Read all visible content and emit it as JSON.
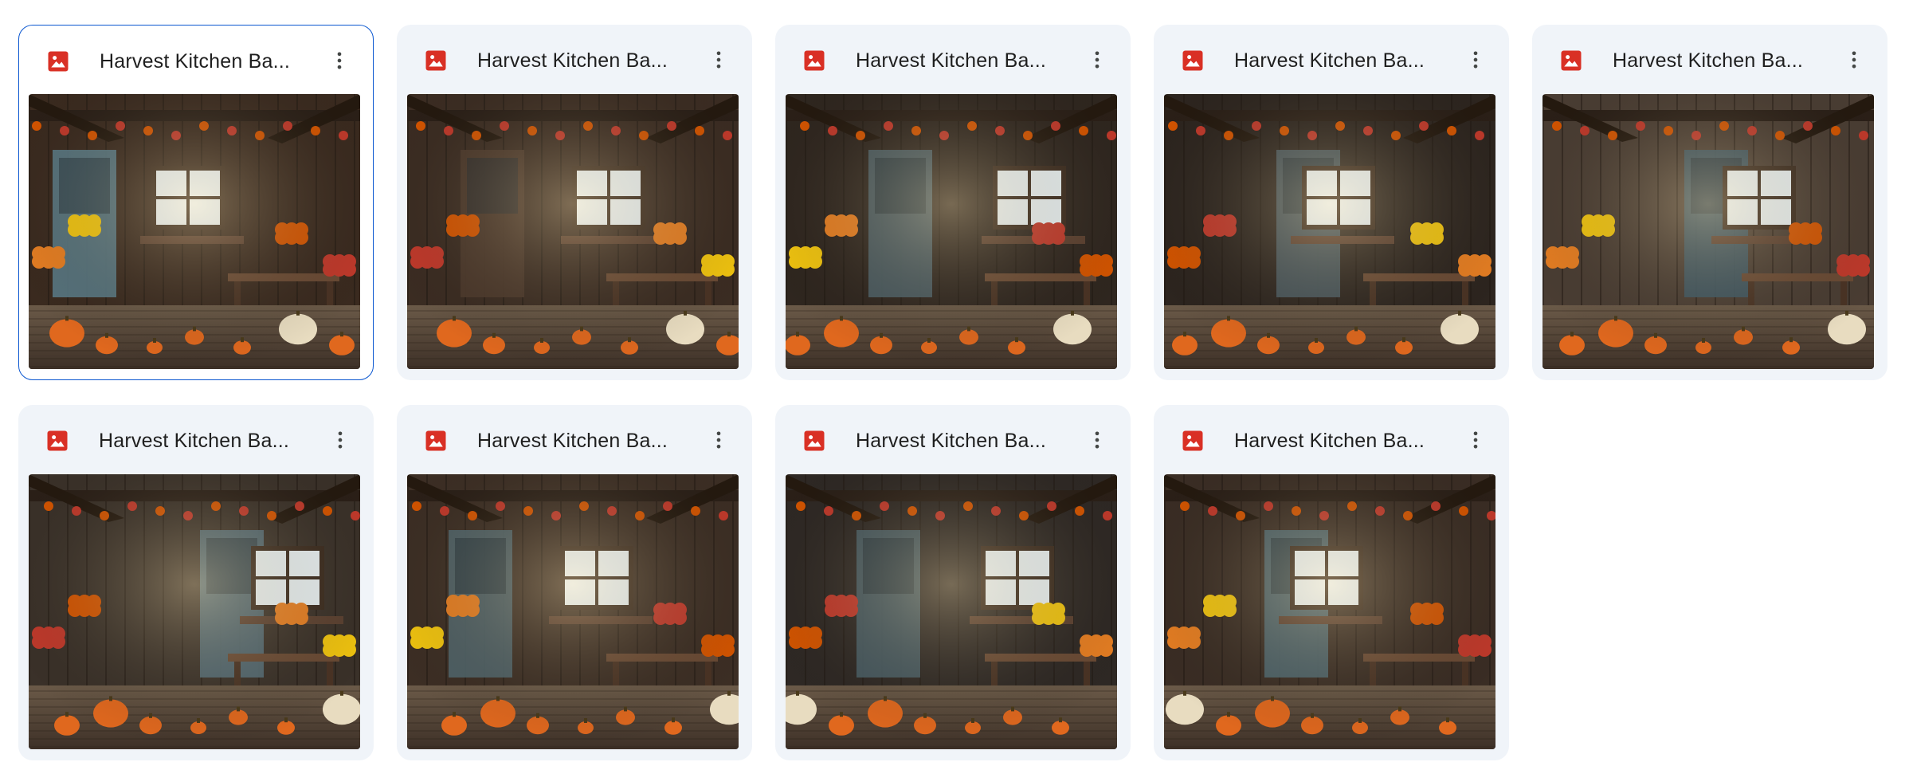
{
  "colors": {
    "selected_border": "#0b57d0",
    "card_background": "#f0f4f9",
    "image_icon_red": "#d93025"
  },
  "files": [
    {
      "name": "Harvest Kitchen Ba...",
      "icon": "image-file-icon",
      "selected": true,
      "variant": 0
    },
    {
      "name": "Harvest Kitchen Ba...",
      "icon": "image-file-icon",
      "selected": false,
      "variant": 1
    },
    {
      "name": "Harvest Kitchen Ba...",
      "icon": "image-file-icon",
      "selected": false,
      "variant": 2
    },
    {
      "name": "Harvest Kitchen Ba...",
      "icon": "image-file-icon",
      "selected": false,
      "variant": 3
    },
    {
      "name": "Harvest Kitchen Ba...",
      "icon": "image-file-icon",
      "selected": false,
      "variant": 4
    },
    {
      "name": "Harvest Kitchen Ba...",
      "icon": "image-file-icon",
      "selected": false,
      "variant": 5
    },
    {
      "name": "Harvest Kitchen Ba...",
      "icon": "image-file-icon",
      "selected": false,
      "variant": 6
    },
    {
      "name": "Harvest Kitchen Ba...",
      "icon": "image-file-icon",
      "selected": false,
      "variant": 7
    },
    {
      "name": "Harvest Kitchen Ba...",
      "icon": "image-file-icon",
      "selected": false,
      "variant": 8
    }
  ]
}
